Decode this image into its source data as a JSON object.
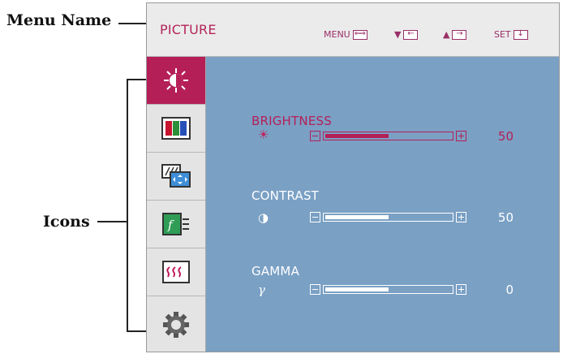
{
  "callouts": {
    "menu_name": "Menu Name",
    "icons": "Icons"
  },
  "header": {
    "title": "PICTURE",
    "hints": [
      {
        "label": "MENU",
        "icon": "menu-exit-icon",
        "glyph": "⟺"
      },
      {
        "label": "▼",
        "icon": "left-arrow-box-icon",
        "glyph": "←"
      },
      {
        "label": "▲",
        "icon": "right-arrow-box-icon",
        "glyph": "→"
      },
      {
        "label": "SET",
        "icon": "down-arrow-box-icon",
        "glyph": "↓"
      }
    ]
  },
  "side_icons": [
    {
      "name": "picture-brightness-icon",
      "active": true
    },
    {
      "name": "color-bars-icon",
      "active": false
    },
    {
      "name": "tracking-screen-icon",
      "active": false
    },
    {
      "name": "function-icon",
      "active": false
    },
    {
      "name": "special-wave-icon",
      "active": false
    },
    {
      "name": "setup-gear-icon",
      "active": false
    }
  ],
  "controls": [
    {
      "label": "BRIGHTNESS",
      "symbol": "☀",
      "value": "50",
      "level": 0.5,
      "selected": true
    },
    {
      "label": "CONTRAST",
      "symbol": "◑",
      "value": "50",
      "level": 0.5,
      "selected": false
    },
    {
      "label": "GAMMA",
      "symbol": "γ",
      "value": "0",
      "level": 0.5,
      "selected": false
    }
  ],
  "colors": {
    "accent": "#b51f58",
    "panel": "#7aa0c4",
    "header_bg": "#ebebeb",
    "sidebar_bg": "#d8d8d8"
  }
}
